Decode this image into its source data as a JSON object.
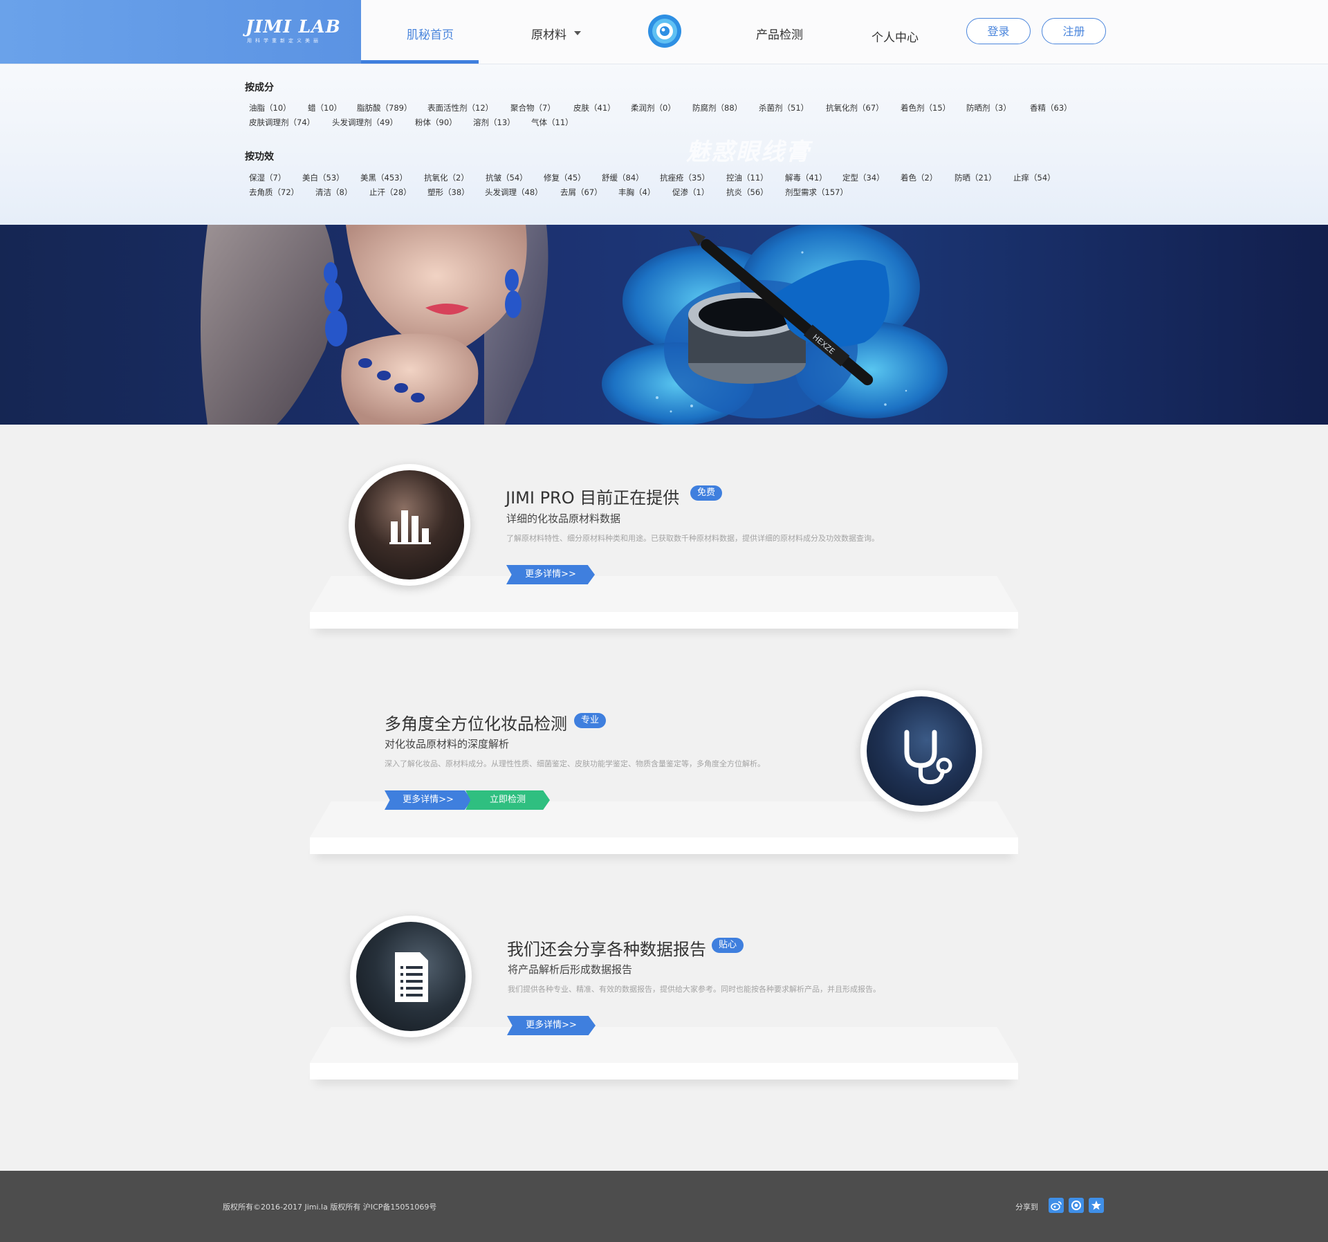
{
  "header": {
    "logo_text": "JIMI LAB",
    "logo_sub": "用科学重新定义美丽",
    "nav": {
      "home": "肌秘首页",
      "materials": "原材料",
      "testing": "产品检测",
      "user": "个人中心"
    },
    "login": "登录",
    "register": "注册"
  },
  "categories": {
    "by_ingredient_title": "按成分",
    "by_ingredient": [
      "油脂（10）",
      "蜡（10）",
      "脂肪酸（789）",
      "表面活性剂（12）",
      "聚合物（7）",
      "皮肤（41）",
      "柔润剂（0）",
      "防腐剂（88）",
      "杀菌剂（51）",
      "抗氧化剂（67）",
      "着色剂（15）",
      "防晒剂（3）",
      "香精（63）",
      "皮肤调理剂（74）",
      "头发调理剂（49）",
      "粉体（90）",
      "溶剂（13）",
      "气体（11）"
    ],
    "by_effect_title": "按功效",
    "by_effect": [
      "保湿（7）",
      "美白（53）",
      "美黑（453）",
      "抗氧化（2）",
      "抗皱（54）",
      "修复（45）",
      "舒缓（84）",
      "抗痤疮（35）",
      "控油（11）",
      "解毒（41）",
      "定型（34）",
      "着色（2）",
      "防晒（21）",
      "止痒（54）",
      "去角质（72）",
      "清洁（8）",
      "止汗（28）",
      "塑形（38）",
      "头发调理（48）",
      "去屑（67）",
      "丰胸（4）",
      "促渗（1）",
      "抗炎（56）",
      "剂型需求（157）"
    ],
    "watermark": "魅惑眼线膏"
  },
  "banner": {
    "product_text": "HEXZE"
  },
  "features": [
    {
      "title": "JIMI PRO 目前正在提供",
      "badge": "免费",
      "subtitle": "详细的化妆品原材料数据",
      "desc": "了解原材料特性、细分原材料种类和用途。已获取数千种原材料数据，提供详细的原材料成分及功效数据查询。",
      "btn_more": "更多详情>>",
      "icon": "bar-chart-icon"
    },
    {
      "title": "多角度全方位化妆品检测",
      "badge": "专业",
      "subtitle": "对化妆品原材料的深度解析",
      "desc": "深入了解化妆品、原材料成分。从理性性质、细菌鉴定、皮肤功能学鉴定、物质含量鉴定等，多角度全方位解析。",
      "btn_more": "更多详情>>",
      "btn_test": "立即检测",
      "icon": "stethoscope-icon"
    },
    {
      "title": "我们还会分享各种数据报告",
      "badge": "贴心",
      "subtitle": "将产品解析后形成数据报告",
      "desc": "我们提供各种专业、精准、有效的数据报告，提供给大家参考。同时也能按各种要求解析产品，并且形成报告。",
      "btn_more": "更多详情>>",
      "icon": "document-icon"
    }
  ],
  "footer": {
    "copyright": "版权所有©2016-2017 Jimi.la 版权所有 沪ICP备15051069号",
    "share_label": "分享到",
    "share_icons": [
      "weibo-icon",
      "qzone-icon",
      "favorite-icon"
    ]
  },
  "colors": {
    "primary": "#3f7fde",
    "green": "#2fbf80",
    "footer_bg": "#4d4d4d"
  }
}
